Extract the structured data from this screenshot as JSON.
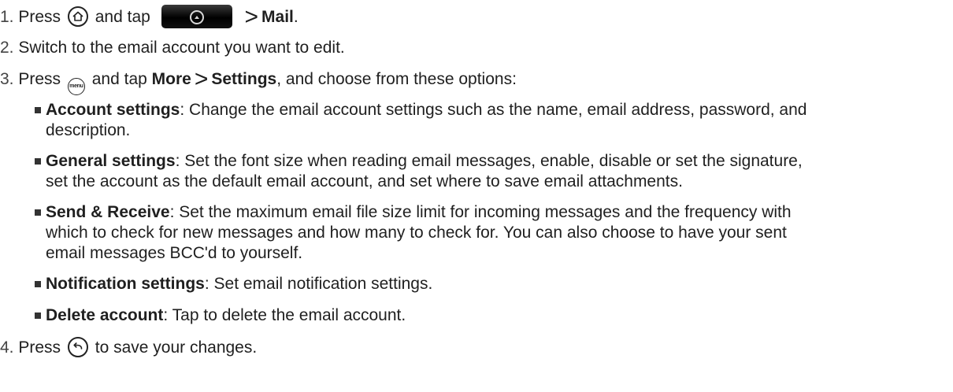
{
  "steps": {
    "s1": {
      "num": "1.",
      "press": "Press",
      "and_tap": "and tap",
      "gt": ">",
      "mail": "Mail",
      "end": "."
    },
    "s2": {
      "num": "2.",
      "text": "Switch to the email account you want to edit."
    },
    "s3": {
      "num": "3.",
      "press": "Press",
      "menu_key_label": "menu",
      "and_tap": "and tap",
      "more": "More",
      "gt": ">",
      "settings": "Settings",
      "rest": ", and choose from these options:"
    },
    "s4": {
      "num": "4.",
      "press": "Press",
      "rest": "to save your changes."
    }
  },
  "options": [
    {
      "title": "Account settings",
      "line1": ": Change the email account settings such as the name, email address, password, and",
      "line2": "description."
    },
    {
      "title": "General settings",
      "line1": ": Set the font size when reading email messages, enable, disable or set the signature,",
      "line2": "set the account as the default email account, and set where to save email attachments."
    },
    {
      "title": "Send & Receive",
      "line1": ": Set the maximum email file size limit for incoming messages and the frequency with",
      "line2": "which to check for new messages and how many to check for. You can also choose to have your sent",
      "line3": "email messages BCC'd to yourself."
    },
    {
      "title": "Notification settings",
      "line1": ": Set email notification settings."
    },
    {
      "title": "Delete account",
      "line1": ": Tap to delete the email account."
    }
  ],
  "icons": {
    "home": "home-key-icon",
    "launcher": "all-apps-launcher-icon",
    "menu": "menu-key-icon",
    "back": "back-key-icon"
  }
}
